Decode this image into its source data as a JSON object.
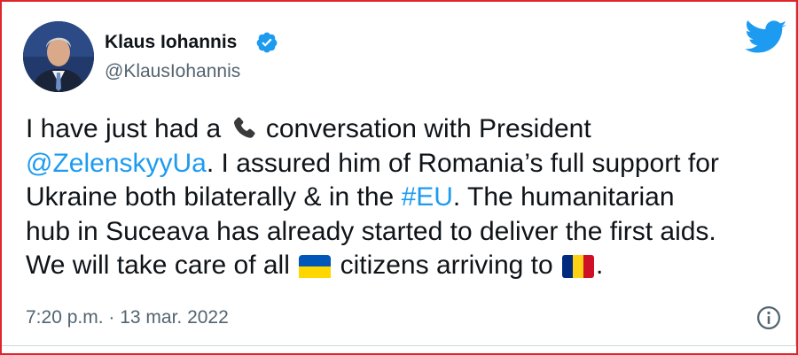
{
  "author": {
    "display_name": "Klaus Iohannis",
    "handle": "@KlausIohannis",
    "avatar_icon": "person-avatar",
    "verified_icon": "verified-badge-icon"
  },
  "brand": {
    "icon": "twitter-bird-icon",
    "color": "#1d9bf0"
  },
  "tweet": {
    "line1_a": "I have just had a",
    "line1_b": "conversation with President",
    "line2_mention": "@ZelenskyyUa",
    "line2_rest": ". I assured him of Romania’s full support for",
    "line3_a": "Ukraine both bilaterally & in the ",
    "line3_hashtag": "#EU",
    "line3_b": ". The humanitarian",
    "line4": "hub in Suceava has already started to deliver the first aids.",
    "line5_a": "We will take care of all",
    "line5_b": "citizens arriving to",
    "line5_end": ".",
    "emojis": [
      "telephone-receiver",
      "flag-ukraine",
      "flag-romania"
    ]
  },
  "meta": {
    "timestamp": "7:20 p.m. · 13 mar. 2022",
    "info_icon": "info-icon"
  },
  "colors": {
    "text": "#0f1419",
    "secondary": "#536471",
    "link": "#1d9bf0",
    "frame_border": "#e0242b"
  }
}
